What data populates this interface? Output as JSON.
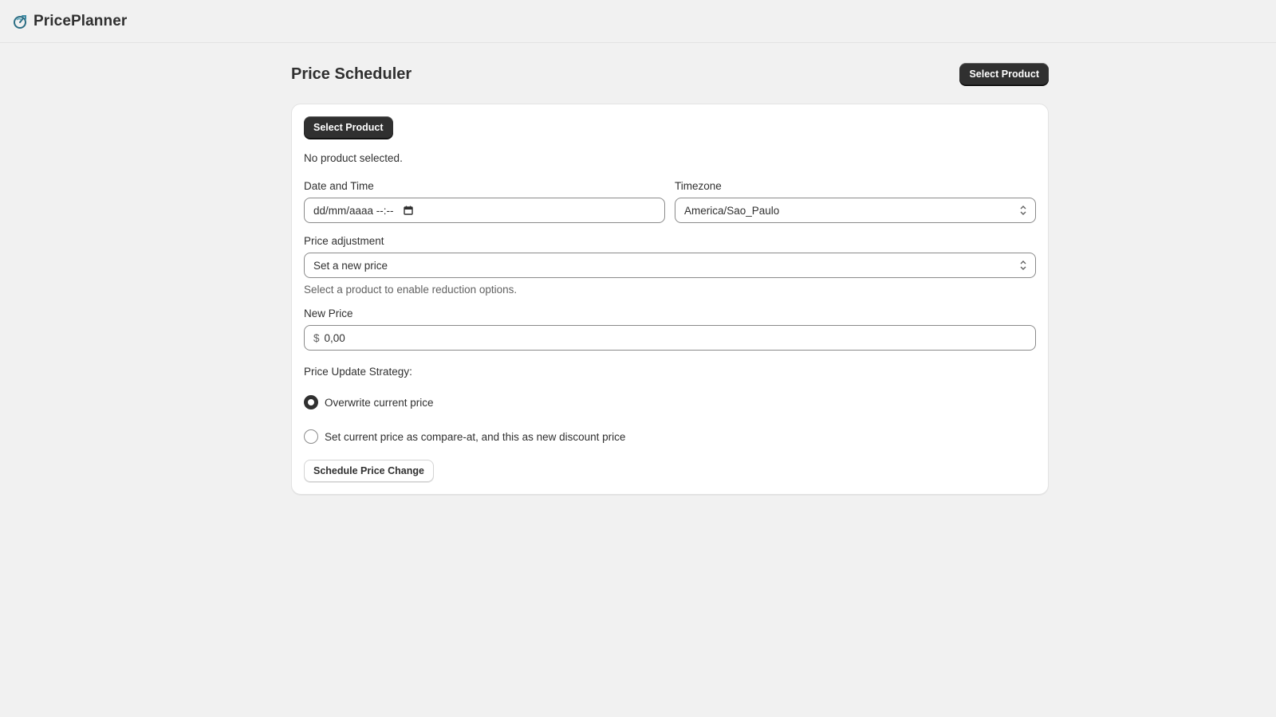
{
  "app": {
    "name": "PricePlanner"
  },
  "page": {
    "title": "Price Scheduler",
    "header_button": "Select Product"
  },
  "card": {
    "select_button": "Select Product",
    "status_text": "No product selected.",
    "datetime": {
      "label": "Date and Time",
      "value": "dd/mm/aaaa --:--"
    },
    "timezone": {
      "label": "Timezone",
      "value": "America/Sao_Paulo"
    },
    "adjustment": {
      "label": "Price adjustment",
      "value": "Set a new price",
      "help": "Select a product to enable reduction options."
    },
    "new_price": {
      "label": "New Price",
      "prefix": "$",
      "value": "0,00"
    },
    "strategy": {
      "label": "Price Update Strategy:",
      "options": [
        {
          "label": "Overwrite current price",
          "checked": true
        },
        {
          "label": "Set current price as compare-at, and this as new discount price",
          "checked": false
        }
      ]
    },
    "submit_button": "Schedule Price Change"
  },
  "colors": {
    "primary_dark": "#303030",
    "background": "#f1f1f1",
    "card": "#ffffff",
    "logo_accent": "#2c6e84"
  }
}
